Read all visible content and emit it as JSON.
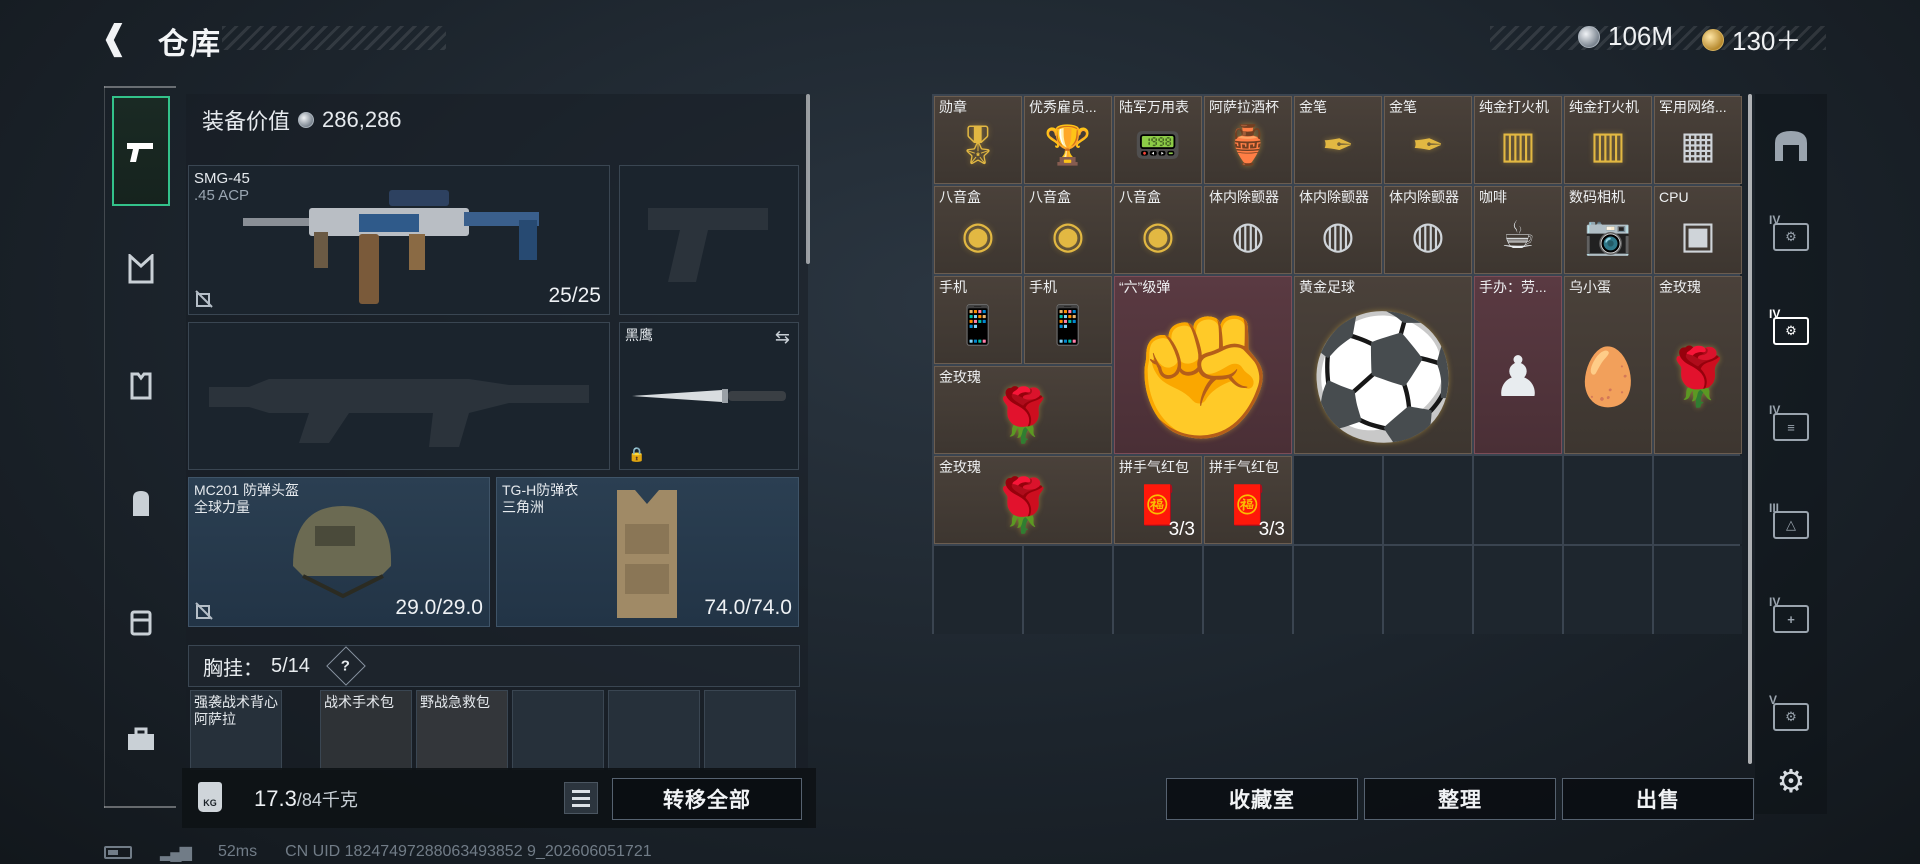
{
  "header": {
    "title": "仓库"
  },
  "currency": {
    "silver": "106M",
    "gold": "130＋"
  },
  "equipment": {
    "value_label": "装备价值",
    "value": "286,286",
    "primary": {
      "name": "SMG-45",
      "ammo_type": ".45 ACP",
      "ammo": "25/25"
    },
    "melee": {
      "name": "黑鹰"
    },
    "helmet": {
      "name": "MC201 防弹头盔",
      "sub": "全球力量",
      "durability": "29.0/29.0"
    },
    "armor": {
      "name": "TG-H防弹衣",
      "sub": "三角洲",
      "durability": "74.0/74.0"
    },
    "chest_rig": {
      "label": "胸挂：",
      "slots": "5/14",
      "help": "?"
    },
    "mini_slots": [
      {
        "name": "强袭战术背心",
        "sub": "阿萨拉"
      },
      {
        "name": "战术手术包",
        "sub": ""
      },
      {
        "name": "野战急救包",
        "sub": ""
      }
    ],
    "weight": {
      "current": "17.3",
      "max": "/84千克",
      "icon": "KG"
    },
    "transfer_all": "转移全部"
  },
  "warehouse": {
    "items": [
      {
        "name": "勋章",
        "icon": "medal-icon"
      },
      {
        "name": "优秀雇员...",
        "icon": "trophy-icon"
      },
      {
        "name": "陆军万用表",
        "icon": "multimeter-icon"
      },
      {
        "name": "阿萨拉酒杯",
        "icon": "goblet-icon"
      },
      {
        "name": "金笔",
        "icon": "gold-pen-icon"
      },
      {
        "name": "金笔",
        "icon": "gold-pen-icon"
      },
      {
        "name": "纯金打火机",
        "icon": "lighter-icon"
      },
      {
        "name": "纯金打火机",
        "icon": "lighter-icon"
      },
      {
        "name": "军用网络...",
        "icon": "network-icon"
      },
      {
        "name": "八音盒",
        "icon": "music-box-icon"
      },
      {
        "name": "八音盒",
        "icon": "music-box-icon"
      },
      {
        "name": "八音盒",
        "icon": "music-box-icon"
      },
      {
        "name": "体内除颤器",
        "icon": "defibrillator-icon"
      },
      {
        "name": "体内除颤器",
        "icon": "defibrillator-icon"
      },
      {
        "name": "体内除颤器",
        "icon": "defibrillator-icon"
      },
      {
        "name": "咖啡",
        "icon": "coffee-icon"
      },
      {
        "name": "数码相机",
        "icon": "camera-icon"
      },
      {
        "name": "CPU",
        "icon": "cpu-icon"
      },
      {
        "name": "手机",
        "icon": "phone-icon"
      },
      {
        "name": "手机",
        "icon": "phone-icon"
      },
      {
        "name": "“六”级弹",
        "icon": "gauntlet-icon"
      },
      {
        "name": "黄金足球",
        "icon": "football-icon"
      },
      {
        "name": "手办：劳...",
        "icon": "figure-icon"
      },
      {
        "name": "乌小蛋",
        "icon": "egg-figure-icon"
      },
      {
        "name": "金玫瑰",
        "icon": "rose-icon"
      },
      {
        "name": "金玫瑰",
        "icon": "rose-icon"
      },
      {
        "name": "金玫瑰",
        "icon": "rose-icon"
      },
      {
        "name": "拼手气红包",
        "icon": "red-envelope-icon",
        "count": "3/3"
      },
      {
        "name": "拼手气红包",
        "icon": "red-envelope-icon",
        "count": "3/3"
      }
    ]
  },
  "actions": {
    "collection": "收藏室",
    "sort": "整理",
    "sell": "出售"
  },
  "status": {
    "ping": "52ms",
    "uid": "CN UID 18247497288063493852 9_202606051721"
  }
}
